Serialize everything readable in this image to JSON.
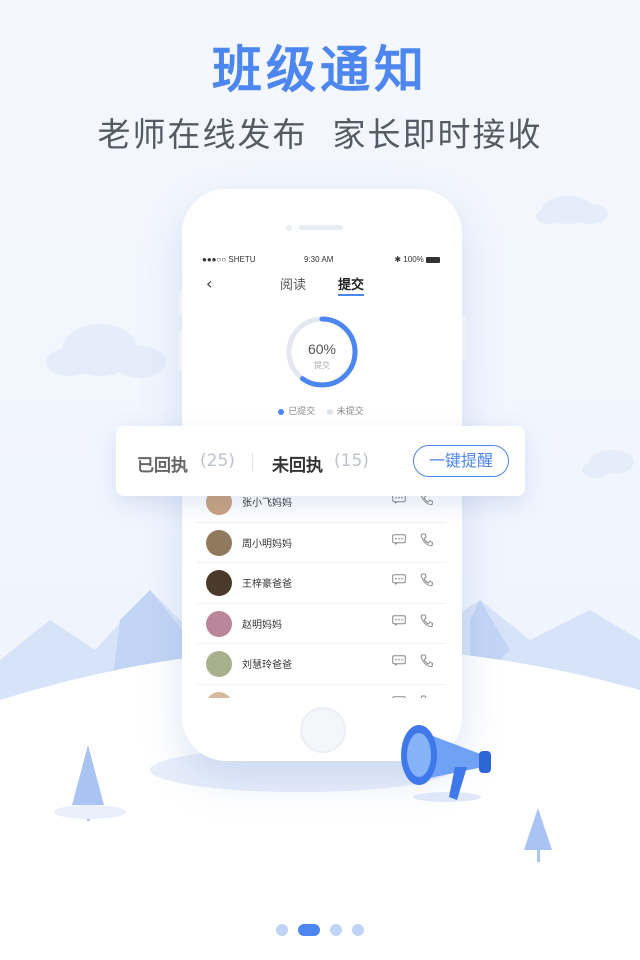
{
  "header": {
    "title": "班级通知",
    "subtitle": "老师在线发布  家长即时接收"
  },
  "status_bar": {
    "carrier": "●●●○○ SHETU",
    "time": "9:30 AM",
    "battery": "100%"
  },
  "nav": {
    "back_icon": "chevron-left-icon",
    "tabs": [
      {
        "label": "阅读",
        "active": false
      },
      {
        "label": "提交",
        "active": true
      }
    ]
  },
  "progress": {
    "percent_text": "60%",
    "value": 0.6,
    "caption": "提交"
  },
  "legend": {
    "submitted": "已提交",
    "not_submitted": "未提交"
  },
  "receipt_card": {
    "replied_label": "已回执",
    "replied_count": "(25)",
    "not_replied_label": "未回执",
    "not_replied_count": "(15)",
    "remind_button": "一键提醒"
  },
  "parents": [
    {
      "name": "张小飞妈妈",
      "avatar_color": "#c9a27e"
    },
    {
      "name": "周小明妈妈",
      "avatar_color": "#8f7a5e"
    },
    {
      "name": "王梓豪爸爸",
      "avatar_color": "#4a3a2c"
    },
    {
      "name": "赵明妈妈",
      "avatar_color": "#b9869a"
    },
    {
      "name": "刘慧玲爸爸",
      "avatar_color": "#a8b08e"
    },
    {
      "name": "",
      "avatar_color": "#d6b89c"
    }
  ],
  "colors": {
    "accent": "#4d86ee",
    "inactive": "#dfe4ee"
  },
  "pagination": {
    "pages": 4,
    "current": 2
  }
}
